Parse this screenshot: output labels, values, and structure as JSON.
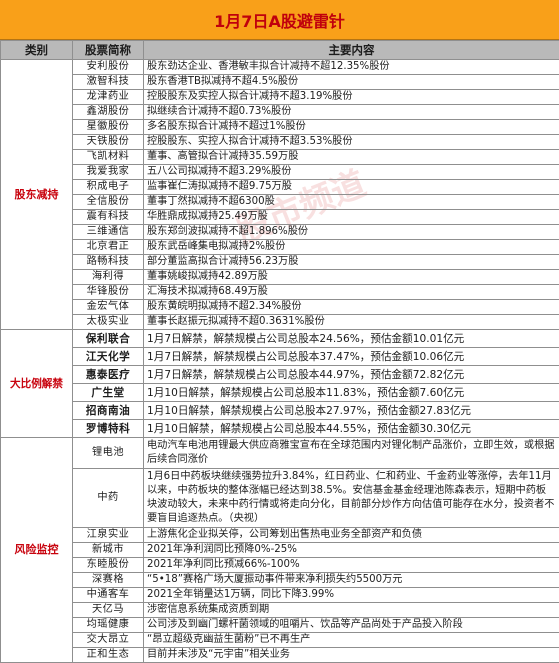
{
  "title": "1月7日A股避雷针",
  "headers": {
    "category": "类别",
    "stock": "股票简称",
    "content": "主要内容"
  },
  "watermark": "股市频道",
  "sections": [
    {
      "category": "股东减持",
      "rows": [
        {
          "stock": "安利股份",
          "content": "股东劲达企业、香港敏丰拟合计减持不超12.35%股份"
        },
        {
          "stock": "激智科技",
          "content": "股东香港TB拟减持不超4.5%股份"
        },
        {
          "stock": "龙津药业",
          "content": "控股股东及实控人拟合计减持不超3.19%股份"
        },
        {
          "stock": "鑫湖股份",
          "content": "拟继续合计减持不超0.73%股份"
        },
        {
          "stock": "星徽股份",
          "content": "多名股东拟合计减持不超过1%股份"
        },
        {
          "stock": "天铁股份",
          "content": "控股股东、实控人拟合计减持不超3.53%股份"
        },
        {
          "stock": "飞凯材料",
          "content": "董事、高管拟合计减持35.59万股"
        },
        {
          "stock": "我爱我家",
          "content": "五八公司拟减持不超3.29%股份"
        },
        {
          "stock": "积成电子",
          "content": "监事崔仁涛拟减持不超9.75万股"
        },
        {
          "stock": "全信股份",
          "content": "董事丁然拟减持不超6300股"
        },
        {
          "stock": "震有科技",
          "content": "华胜鼎成拟减持25.49万股"
        },
        {
          "stock": "三维通信",
          "content": "股东郑剑波拟减持不超1.896%股份"
        },
        {
          "stock": "北京君正",
          "content": "股东武岳峰集电拟减持2%股份"
        },
        {
          "stock": "路畅科技",
          "content": "部分董监高拟合计减持56.23万股"
        },
        {
          "stock": "海利得",
          "content": "董事姚峻拟减持42.89万股"
        },
        {
          "stock": "华锋股份",
          "content": "汇海技术拟减持68.49万股"
        },
        {
          "stock": "金宏气体",
          "content": "股东黄皖明拟减持不超2.34%股份"
        },
        {
          "stock": "太极实业",
          "content": "董事长赵振元拟减持不超0.3631%股份"
        }
      ]
    },
    {
      "category": "大比例解禁",
      "rows": [
        {
          "stock": "保利联合",
          "content": "1月7日解禁，解禁规模占公司总股本24.56%，预估金额10.01亿元"
        },
        {
          "stock": "江天化学",
          "content": "1月7日解禁，解禁规模占公司总股本37.47%，预估金额10.06亿元"
        },
        {
          "stock": "惠泰医疗",
          "content": "1月7日解禁，解禁规模占公司总股本44.97%，预估金额72.82亿元"
        },
        {
          "stock": "广生堂",
          "content": "1月10日解禁，解禁规模占公司总股本11.83%，预估金额7.60亿元"
        },
        {
          "stock": "招商南油",
          "content": "1月10日解禁，解禁规模占公司总股本27.97%，预估金额27.83亿元"
        },
        {
          "stock": "罗博特科",
          "content": "1月10日解禁，解禁规模占公司总股本44.55%，预估金额30.30亿元"
        }
      ]
    },
    {
      "category": "风险监控",
      "rows": [
        {
          "stock": "锂电池",
          "content": "电动汽车电池用锂最大供应商雅宝宣布在全球范围内对锂化制产品涨价，立即生效，或根据后续合同涨价"
        },
        {
          "stock": "中药",
          "content": "1月6日中药板块继续强势拉升3.84%，红日药业、仁和药业、千金药业等涨停，去年11月以来，中药板块的整体涨幅已经达到38.5%。安信基金基金经理池陈森表示，短期中药板块波动较大，未来中药行情或将走向分化，目前部分炒作方向估值可能存在水分，投资者不要盲目追逐热点。（央视）"
        },
        {
          "stock": "江泉实业",
          "content": "上游焦化企业拟关停，公司筹划出售热电业务全部资产和负债"
        },
        {
          "stock": "新城市",
          "content": "2021年净利润同比预降0%-25%"
        },
        {
          "stock": "东睦股份",
          "content": "2021年净利同比预减66%-100%"
        },
        {
          "stock": "深赛格",
          "content": "“5•18”赛格广场大厦振动事件带来净利损失约5500万元"
        },
        {
          "stock": "中通客车",
          "content": "2021全年销量达1万辆，同比下降3.99%"
        },
        {
          "stock": "天亿马",
          "content": "涉密信息系统集成资质到期"
        },
        {
          "stock": "均瑶健康",
          "content": "公司涉及到幽门螺杆菌领域的咀嚼片、饮品等产品尚处于产品投入阶段"
        },
        {
          "stock": "交大昂立",
          "content": "“昂立超级克幽益生菌粉”已不再生产"
        },
        {
          "stock": "正和生态",
          "content": "目前并未涉及“元宇宙”相关业务"
        }
      ]
    }
  ]
}
